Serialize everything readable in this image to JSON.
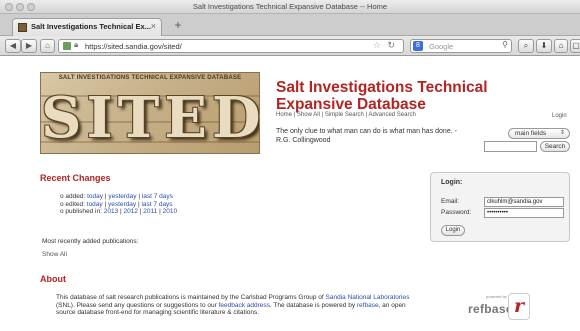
{
  "window": {
    "title": "Salt Investigations Technical Expansive Database -- Home",
    "tab_label": "Salt Investigations Technical Ex...",
    "new_tab": "+"
  },
  "browser": {
    "url": "https://sited.sandia.gov/sited/",
    "search_placeholder": "Google",
    "search_engine_icon": "google-icon"
  },
  "header": {
    "logo_top_text": "SALT INVESTIGATIONS TECHNICAL EXPANSIVE DATABASE",
    "logo_word": "SITED",
    "title": "Salt Investigations Technical Expansive Database",
    "nav": [
      "Home",
      "Show All",
      "Simple Search",
      "Advanced Search"
    ],
    "quote": "The only clue to what man can do is what man has done. - R.G. Collingwood",
    "login_link": "Login",
    "field_select": "main fields",
    "search_button": "Search"
  },
  "recent": {
    "heading": "Recent Changes",
    "added_label": "added:",
    "edited_label": "edited:",
    "published_label": "published in:",
    "added_links": [
      "today",
      "yesterday",
      "last 7 days"
    ],
    "edited_links": [
      "today",
      "yesterday",
      "last 7 days"
    ],
    "published_links": [
      "2013",
      "2012",
      "2011",
      "2010"
    ],
    "most_recent": "Most recently added publications:",
    "show_all": "Show All"
  },
  "login": {
    "title": "Login:",
    "email_label": "Email:",
    "email_value": "clkuhlm@sandia.gov",
    "password_label": "Password:",
    "password_value": "••••••••••",
    "button": "Login"
  },
  "about": {
    "heading": "About",
    "text_1": "This database of salt research publications is maintained by the Carlsbad Programs Group of ",
    "link_snl": "Sandia National Laboratories",
    "text_2": " (SNL). Please send any questions or suggestions to our ",
    "link_feedback": "feedback address",
    "text_3": ". The database is powered by ",
    "link_refbase": "refbase",
    "text_4": ", an open source database front-end for managing scientific literature & citations."
  },
  "refbase": {
    "powered_by": "powered by",
    "word": "refbase",
    "mark": "r"
  }
}
